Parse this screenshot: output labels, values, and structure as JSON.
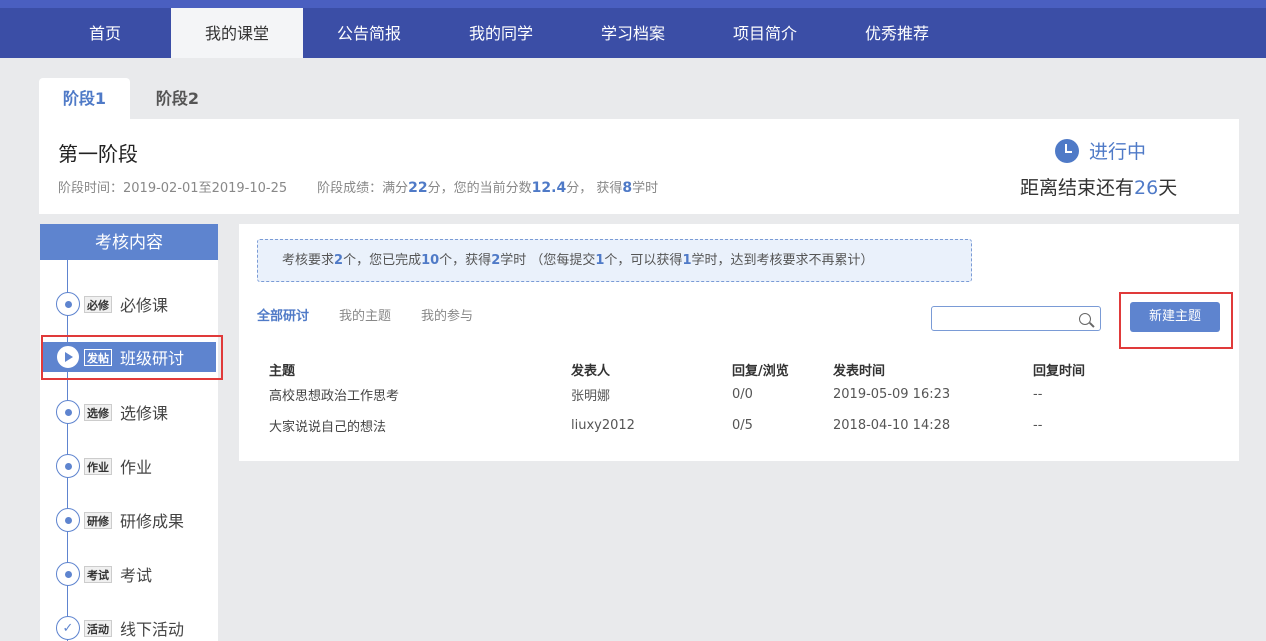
{
  "nav": {
    "items": [
      "首页",
      "我的课堂",
      "公告简报",
      "我的同学",
      "学习档案",
      "项目简介",
      "优秀推荐"
    ],
    "active": "我的课堂"
  },
  "stage_tabs": [
    "阶段1",
    "阶段2"
  ],
  "stage": {
    "title": "第一阶段",
    "time_label": "阶段时间：",
    "time_value": "2019-02-01至2019-10-25",
    "score_label": "阶段成绩：满分",
    "full_score": "22",
    "score_mid": "分，您的当前分数",
    "current_score": "12.4",
    "score_mid2": "分， 获得",
    "hours": "8",
    "score_tail": "学时",
    "status": "进行中",
    "countdown_prefix": "距离结束还有",
    "countdown_days": "26",
    "countdown_suffix": "天"
  },
  "sidebar": {
    "title": "考核内容",
    "items": [
      {
        "tag": "必修",
        "label": "必修课"
      },
      {
        "tag": "发帖",
        "label": "班级研讨"
      },
      {
        "tag": "选修",
        "label": "选修课"
      },
      {
        "tag": "作业",
        "label": "作业"
      },
      {
        "tag": "研修",
        "label": "研修成果"
      },
      {
        "tag": "考试",
        "label": "考试"
      },
      {
        "tag": "活动",
        "label": "线下活动"
      }
    ]
  },
  "notice": {
    "p1": "考核要求",
    "req": "2",
    "p2": "个，您已完成",
    "done": "10",
    "p3": "个，获得",
    "got": "2",
    "p4": "学时 （您每提交",
    "each": "1",
    "p5": "个，可以获得",
    "per": "1",
    "p6": "学时，达到考核要求不再累计）"
  },
  "subtabs": [
    "全部研讨",
    "我的主题",
    "我的参与"
  ],
  "search": {
    "placeholder": ""
  },
  "new_button": "新建主题",
  "table": {
    "headers": [
      "主题",
      "发表人",
      "回复/浏览",
      "发表时间",
      "回复时间"
    ],
    "rows": [
      [
        "高校思想政治工作思考",
        "张明娜",
        "0/0",
        "2019-05-09 16:23",
        "--"
      ],
      [
        "大家说说自己的想法",
        "liuxy2012",
        "0/5",
        "2018-04-10 14:28",
        "--"
      ]
    ]
  },
  "colors": {
    "nav_bg": "#3b4ea6",
    "accent": "#5e84cf",
    "highlight_box": "#e03a3a"
  }
}
